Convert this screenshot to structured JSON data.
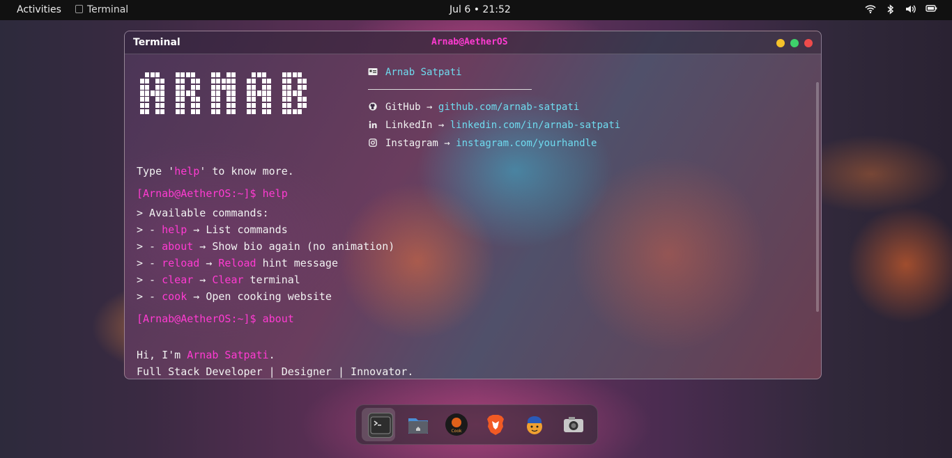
{
  "topbar": {
    "activities": "Activities",
    "app_name": "Terminal",
    "clock": "Jul 6 • 21:52",
    "tray_icons": [
      "wifi-icon",
      "bluetooth-icon",
      "volume-icon",
      "battery-icon"
    ]
  },
  "window": {
    "title": "Terminal",
    "center_title": "Arnab@AetherOS",
    "controls": [
      "minimize",
      "maximize",
      "close"
    ]
  },
  "terminal": {
    "ascii_name": "ARNAB",
    "profile": {
      "name": "Arnab Satpati",
      "github_label": "GitHub",
      "github_url": "github.com/arnab-satpati",
      "linkedin_label": "LinkedIn",
      "linkedin_url": "linkedin.com/in/arnab-satpati",
      "instagram_label": "Instagram",
      "instagram_url": "instagram.com/yourhandle",
      "arrow": "→"
    },
    "hint_prefix": "Type '",
    "hint_cmd": "help",
    "hint_suffix": "' to know more.",
    "prompt": "[Arnab@AetherOS:~]$",
    "cmd1": "help",
    "available": "> Available commands:",
    "commands": [
      {
        "prefix": "> - ",
        "cmd": "help",
        "sep": " → ",
        "desc": "List commands",
        "desc_hl": "",
        "desc_rest": ""
      },
      {
        "prefix": "> - ",
        "cmd": "about",
        "sep": " → ",
        "desc": "Show bio again (no animation)",
        "desc_hl": "",
        "desc_rest": ""
      },
      {
        "prefix": "> - ",
        "cmd": "reload",
        "sep": " → ",
        "desc": "",
        "desc_hl": "Reload",
        "desc_rest": " hint message"
      },
      {
        "prefix": "> - ",
        "cmd": "clear",
        "sep": " → ",
        "desc": "",
        "desc_hl": "Clear",
        "desc_rest": " terminal"
      },
      {
        "prefix": "> - ",
        "cmd": "cook",
        "sep": " → ",
        "desc": "Open cooking website",
        "desc_hl": "",
        "desc_rest": ""
      }
    ],
    "cmd2": "about",
    "bio_prefix": "Hi, I'm ",
    "bio_name": "Arnab Satpati",
    "bio_suffix": ".",
    "bio_line2": "Full Stack Developer | Designer | Innovator."
  },
  "dock": {
    "apps": [
      "terminal-icon",
      "files-icon",
      "cook-app-icon",
      "brave-browser-icon",
      "chef-app-icon",
      "camera-icon"
    ],
    "cook_label": "Cook"
  },
  "colors": {
    "accent_pink": "#ff3bd2",
    "link_cyan": "#6fdcf0"
  }
}
